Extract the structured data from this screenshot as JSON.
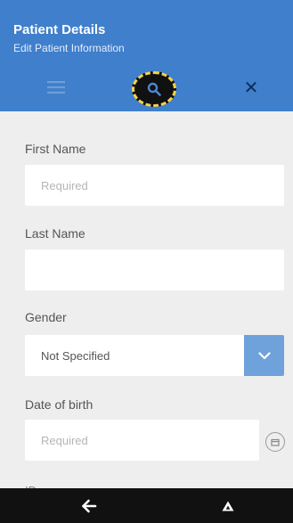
{
  "header": {
    "title": "Patient Details",
    "subtitle": "Edit Patient Information",
    "background": "#3f7fcb"
  },
  "toolbar": {
    "icons": [
      "list-icon",
      "search-icon",
      "close-icon"
    ],
    "close_glyph": "✕"
  },
  "form": {
    "first_name": {
      "label": "First Name",
      "placeholder": "Required",
      "value": ""
    },
    "last_name": {
      "label": "Last Name",
      "placeholder": "",
      "value": ""
    },
    "gender": {
      "label": "Gender",
      "selected": "Not Specified"
    },
    "date_of_birth": {
      "label": "Date of birth",
      "placeholder": "Required",
      "value": ""
    },
    "id": {
      "label": "ID"
    }
  },
  "navigation": {
    "icons": [
      "back-arrow-icon",
      "home-triangle-icon"
    ]
  },
  "colors": {
    "accent": "#3f7fcb",
    "select_button": "#6fa2db",
    "background": "#eeeeee",
    "nav_bar": "#111111",
    "highlight_ring": "#f3d24a"
  }
}
